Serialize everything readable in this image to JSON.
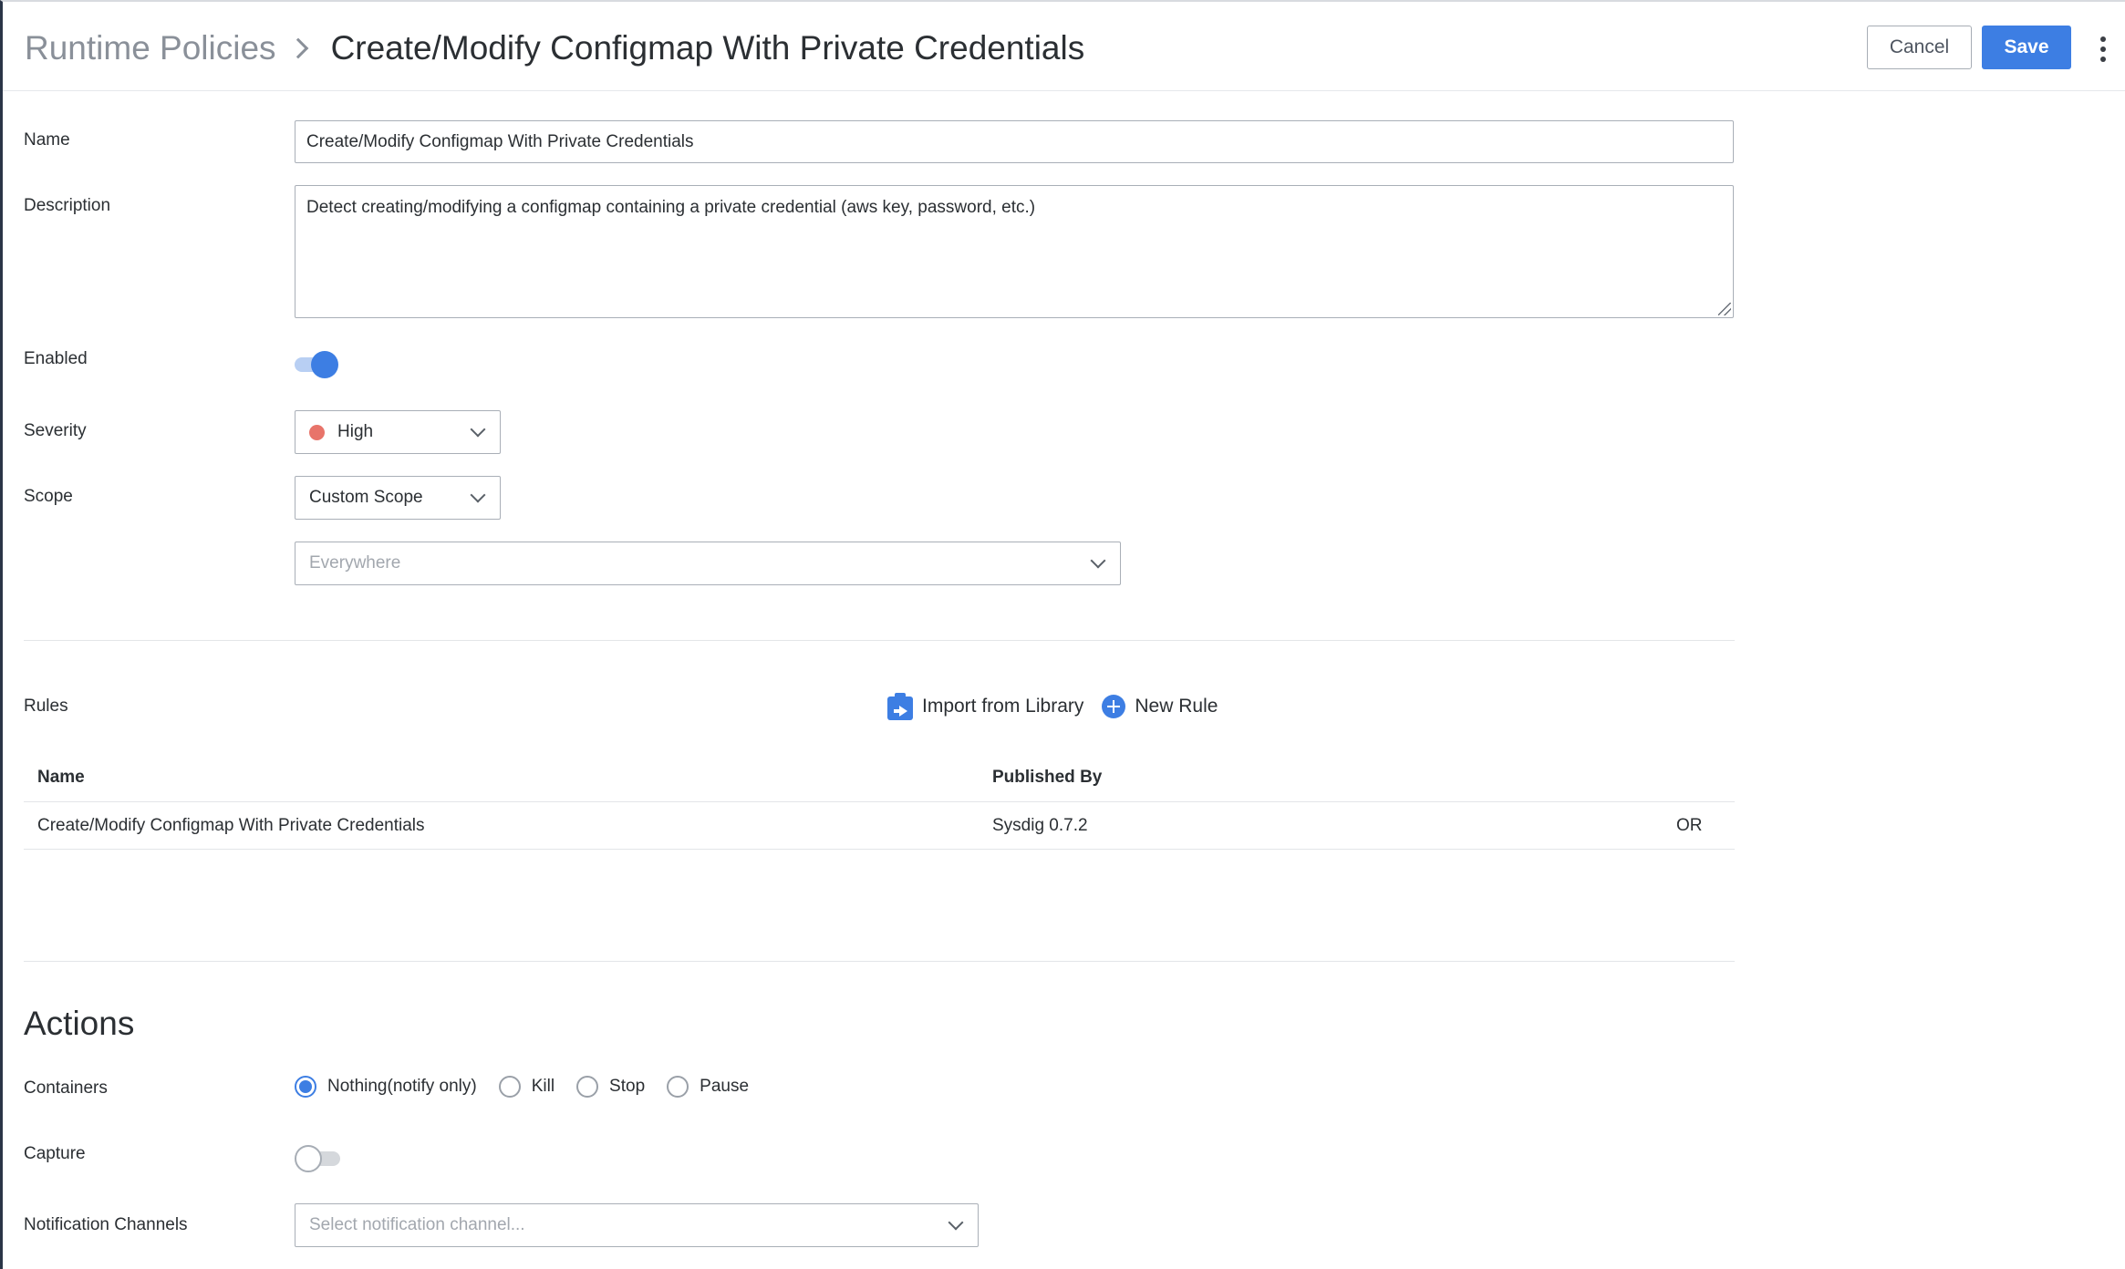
{
  "header": {
    "breadcrumb_parent": "Runtime Policies",
    "title": "Create/Modify Configmap With Private Credentials",
    "cancel_label": "Cancel",
    "save_label": "Save"
  },
  "form": {
    "name_label": "Name",
    "name_value": "Create/Modify Configmap With Private Credentials",
    "description_label": "Description",
    "description_value": "Detect creating/modifying a configmap containing a private credential (aws key, password, etc.)",
    "enabled_label": "Enabled",
    "enabled": true,
    "severity_label": "Severity",
    "severity_value": "High",
    "severity_color": "#e8746a",
    "scope_label": "Scope",
    "scope_value": "Custom Scope",
    "scope_filter_placeholder": "Everywhere"
  },
  "rules": {
    "label": "Rules",
    "import_label": "Import from Library",
    "new_rule_label": "New Rule",
    "columns": [
      "Name",
      "Published By"
    ],
    "rows": [
      {
        "name": "Create/Modify Configmap With Private Credentials",
        "published_by": "Sysdig 0.7.2",
        "operator": "OR"
      }
    ]
  },
  "actions": {
    "title": "Actions",
    "containers_label": "Containers",
    "container_options": [
      "Nothing(notify only)",
      "Kill",
      "Stop",
      "Pause"
    ],
    "container_selected": "Nothing(notify only)",
    "capture_label": "Capture",
    "capture_enabled": false,
    "notification_label": "Notification Channels",
    "notification_placeholder": "Select notification channel..."
  },
  "colors": {
    "accent": "#3d7ee3"
  }
}
